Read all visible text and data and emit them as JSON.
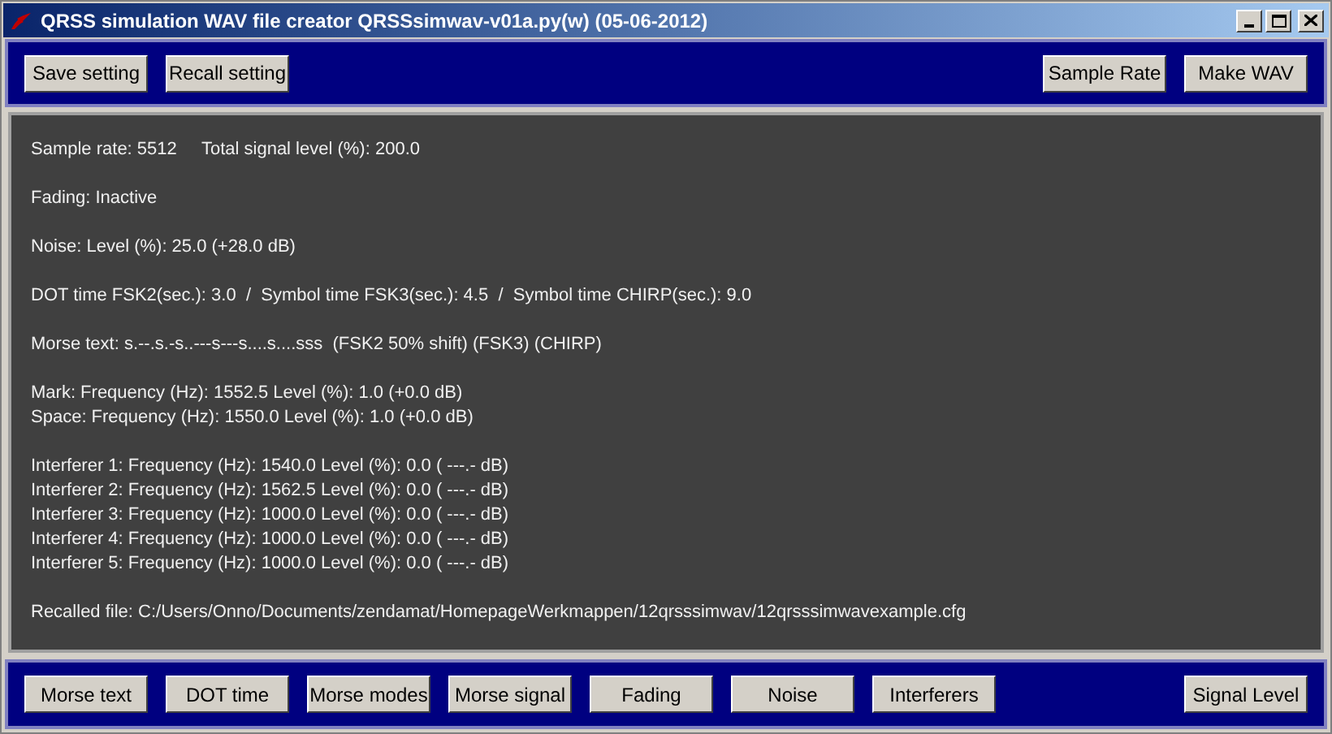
{
  "window": {
    "title": "QRSS simulation WAV file creator QRSSsimwav-v01a.py(w) (05-06-2012)"
  },
  "top_toolbar": {
    "left_buttons": [
      "Save setting",
      "Recall setting"
    ],
    "right_buttons": [
      "Sample Rate",
      "Make WAV"
    ]
  },
  "info_panel": [
    [
      "Sample rate: 5512     Total signal level (%): 200.0"
    ],
    [
      "Fading: Inactive"
    ],
    [
      "Noise: Level (%): 25.0 (+28.0 dB)"
    ],
    [
      "DOT time FSK2(sec.): 3.0  /  Symbol time FSK3(sec.): 4.5  /  Symbol time CHIRP(sec.): 9.0"
    ],
    [
      "Morse text: s.--.s.-s..---s---s....s....sss  (FSK2 50% shift) (FSK3) (CHIRP)"
    ],
    [
      "Mark: Frequency (Hz): 1552.5 Level (%): 1.0 (+0.0 dB)",
      "Space: Frequency (Hz): 1550.0 Level (%): 1.0 (+0.0 dB)"
    ],
    [
      "Interferer 1: Frequency (Hz): 1540.0 Level (%): 0.0 ( ---.- dB)",
      "Interferer 2: Frequency (Hz): 1562.5 Level (%): 0.0 ( ---.- dB)",
      "Interferer 3: Frequency (Hz): 1000.0 Level (%): 0.0 ( ---.- dB)",
      "Interferer 4: Frequency (Hz): 1000.0 Level (%): 0.0 ( ---.- dB)",
      "Interferer 5: Frequency (Hz): 1000.0 Level (%): 0.0 ( ---.- dB)"
    ],
    [
      "Recalled file: C:/Users/Onno/Documents/zendamat/HomepageWerkmappen/12qrsssimwav/12qrsssimwavexample.cfg"
    ]
  ],
  "bottom_toolbar": {
    "left_buttons": [
      "Morse text",
      "DOT time",
      "Morse modes",
      "Morse signal",
      "Fading",
      "Noise",
      "Interferers"
    ],
    "right_buttons": [
      "Signal Level"
    ]
  }
}
